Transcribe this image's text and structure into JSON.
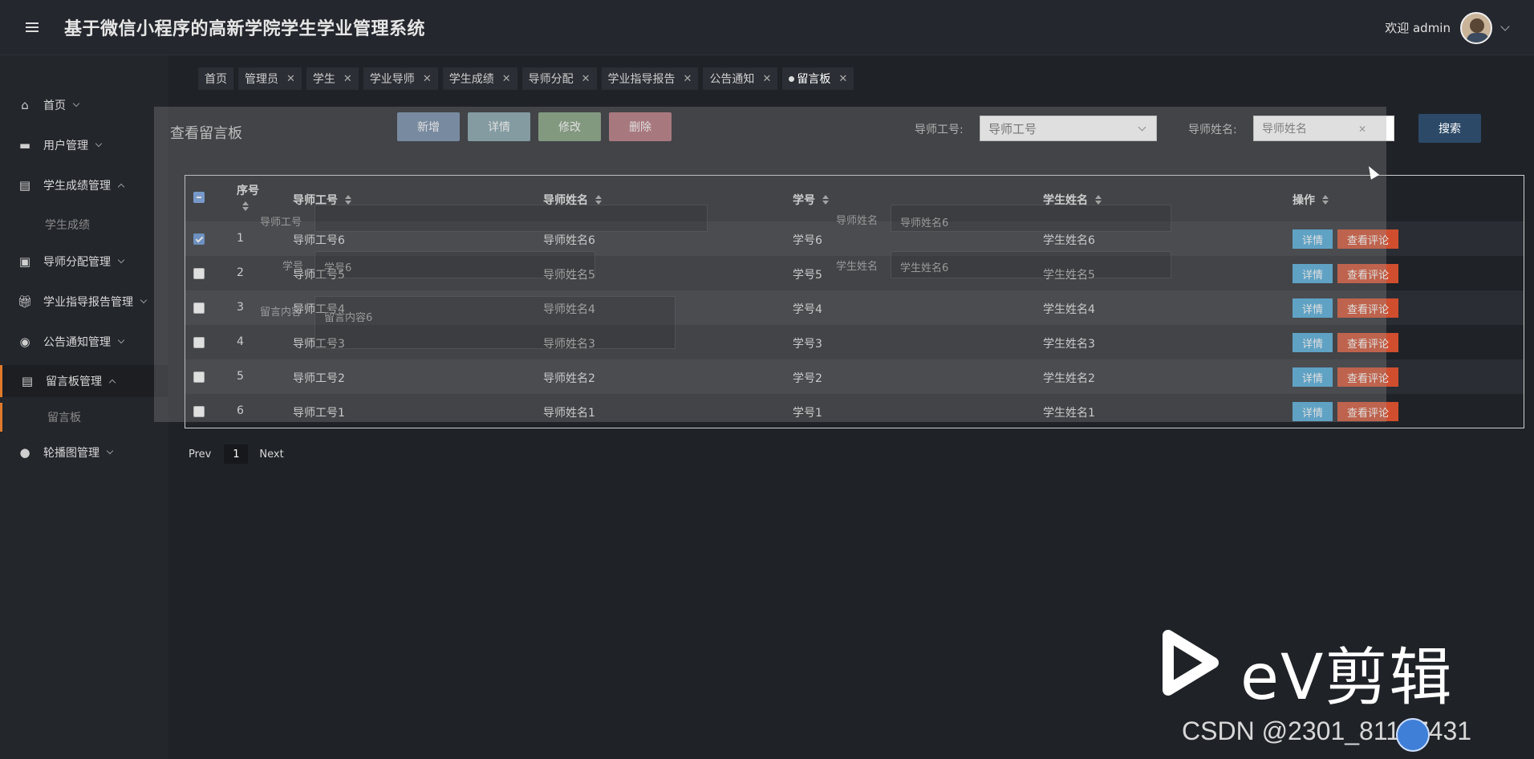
{
  "header": {
    "title": "基于微信小程序的高新学院学生学业管理系统",
    "welcome": "欢迎 admin"
  },
  "sidebar": {
    "items": [
      {
        "label": "首页",
        "icon": "home-icon"
      },
      {
        "label": "用户管理",
        "icon": "ticket-icon"
      },
      {
        "label": "学生成绩管理",
        "icon": "table-icon",
        "expanded": true,
        "sub": [
          "学生成绩"
        ]
      },
      {
        "label": "导师分配管理",
        "icon": "book-icon"
      },
      {
        "label": "学业指导报告管理",
        "icon": "gift-icon"
      },
      {
        "label": "公告通知管理",
        "icon": "compass-icon"
      },
      {
        "label": "留言板管理",
        "icon": "table-icon",
        "expanded": true,
        "active": true,
        "sub": [
          "留言板"
        ]
      },
      {
        "label": "轮播图管理",
        "icon": "drop-icon"
      }
    ]
  },
  "tabs": [
    {
      "label": "首页",
      "closable": false
    },
    {
      "label": "管理员",
      "closable": true
    },
    {
      "label": "学生",
      "closable": true
    },
    {
      "label": "学业导师",
      "closable": true
    },
    {
      "label": "学生成绩",
      "closable": true
    },
    {
      "label": "导师分配",
      "closable": true
    },
    {
      "label": "学业指导报告",
      "closable": true
    },
    {
      "label": "公告通知",
      "closable": true
    },
    {
      "label": "留言板",
      "closable": true,
      "current": true
    }
  ],
  "content": {
    "title": "查看留言板",
    "buttons": {
      "add": "新增",
      "detail": "详情",
      "edit": "修改",
      "delete": "删除"
    },
    "filters": {
      "teacher_id_label": "导师工号:",
      "teacher_id_placeholder": "导师工号",
      "teacher_name_label": "导师姓名:",
      "teacher_name_placeholder": "导师姓名",
      "search": "搜索"
    }
  },
  "table": {
    "columns": [
      "序号",
      "导师工号",
      "导师姓名",
      "学号",
      "学生姓名",
      "操作"
    ],
    "rows": [
      {
        "index": "1",
        "teacher_id": "导师工号6",
        "teacher_name": "导师姓名6",
        "student_id": "学号6",
        "student_name": "学生姓名6",
        "checked": true
      },
      {
        "index": "2",
        "teacher_id": "导师工号5",
        "teacher_name": "导师姓名5",
        "student_id": "学号5",
        "student_name": "学生姓名5",
        "checked": false
      },
      {
        "index": "3",
        "teacher_id": "导师工号4",
        "teacher_name": "导师姓名4",
        "student_id": "学号4",
        "student_name": "学生姓名4",
        "checked": false
      },
      {
        "index": "4",
        "teacher_id": "导师工号3",
        "teacher_name": "导师姓名3",
        "student_id": "学号3",
        "student_name": "学生姓名3",
        "checked": false
      },
      {
        "index": "5",
        "teacher_id": "导师工号2",
        "teacher_name": "导师姓名2",
        "student_id": "学号2",
        "student_name": "学生姓名2",
        "checked": false
      },
      {
        "index": "6",
        "teacher_id": "导师工号1",
        "teacher_name": "导师姓名1",
        "student_id": "学号1",
        "student_name": "学生姓名1",
        "checked": false
      }
    ],
    "row_actions": {
      "detail": "详情",
      "comment": "查看评论"
    }
  },
  "pager": {
    "prev": "Prev",
    "page": "1",
    "next": "Next"
  },
  "modal_ghost": {
    "teacher_id_label": "导师工号",
    "teacher_name_label": "导师姓名",
    "teacher_name_value": "导师姓名6",
    "student_id_label": "学号",
    "student_id_value": "学号6",
    "student_name_label": "学生姓名",
    "student_name_value": "学生姓名6",
    "message_label": "留言内容",
    "message_value": "留言内容6"
  },
  "watermark": {
    "ev_text": "eV剪辑",
    "csdn": "CSDN @2301_81127431"
  },
  "colors": {
    "accent": "#e07a2a",
    "detail_btn": "#4aa8d8",
    "comment_btn": "#d04e2e",
    "search_btn": "#2c4a68"
  }
}
